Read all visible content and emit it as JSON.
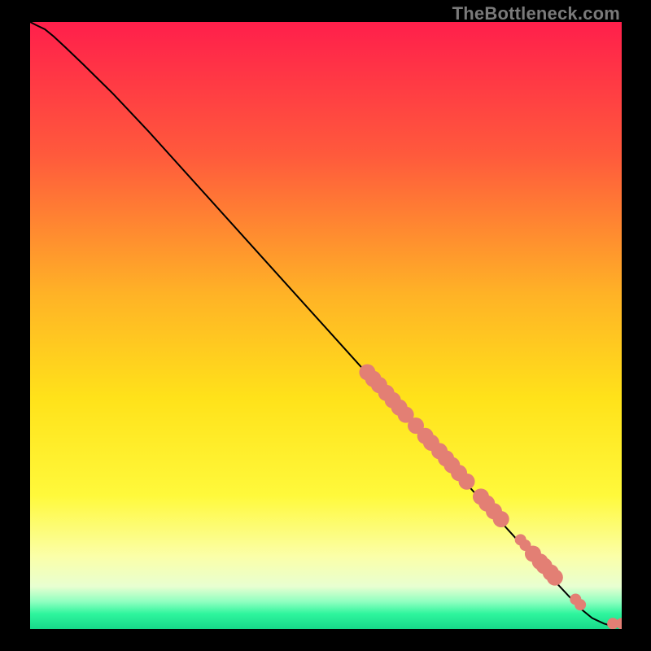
{
  "attribution": "TheBottleneck.com",
  "chart_data": {
    "type": "line",
    "title": "",
    "xlabel": "",
    "ylabel": "",
    "xlim": [
      0,
      100
    ],
    "ylim": [
      0,
      100
    ],
    "grid": false,
    "background": {
      "type": "vertical-gradient",
      "stops": [
        {
          "offset": 0.0,
          "color": "#ff1f4b"
        },
        {
          "offset": 0.22,
          "color": "#ff5a3c"
        },
        {
          "offset": 0.45,
          "color": "#ffb326"
        },
        {
          "offset": 0.62,
          "color": "#ffe21a"
        },
        {
          "offset": 0.78,
          "color": "#fff93b"
        },
        {
          "offset": 0.88,
          "color": "#fbffa8"
        },
        {
          "offset": 0.93,
          "color": "#e8ffd1"
        },
        {
          "offset": 0.955,
          "color": "#8fffc0"
        },
        {
          "offset": 0.975,
          "color": "#2ef59d"
        },
        {
          "offset": 1.0,
          "color": "#17d98a"
        }
      ]
    },
    "series": [
      {
        "name": "main-curve",
        "color": "#000000",
        "x": [
          0.0,
          1.0,
          2.5,
          4.0,
          6.0,
          9.0,
          14.0,
          20.0,
          30.0,
          40.0,
          50.0,
          60.0,
          70.0,
          80.0,
          88.0,
          93.0,
          95.0,
          97.0,
          98.0,
          99.0,
          99.5,
          100.0
        ],
        "y": [
          100.0,
          99.5,
          98.8,
          97.6,
          95.8,
          93.0,
          88.2,
          82.0,
          71.2,
          60.4,
          49.6,
          38.8,
          28.0,
          17.2,
          8.6,
          3.4,
          1.8,
          0.9,
          0.6,
          0.5,
          0.5,
          0.5
        ]
      }
    ],
    "markers": {
      "color": "#e37f74",
      "radius_big": 10,
      "radius_small": 7,
      "points": [
        {
          "x": 57.0,
          "y": 42.3,
          "r": "big"
        },
        {
          "x": 58.0,
          "y": 41.2,
          "r": "big"
        },
        {
          "x": 59.0,
          "y": 40.2,
          "r": "big"
        },
        {
          "x": 60.2,
          "y": 38.9,
          "r": "big"
        },
        {
          "x": 61.3,
          "y": 37.7,
          "r": "big"
        },
        {
          "x": 62.4,
          "y": 36.5,
          "r": "big"
        },
        {
          "x": 63.5,
          "y": 35.3,
          "r": "big"
        },
        {
          "x": 65.2,
          "y": 33.5,
          "r": "big"
        },
        {
          "x": 66.8,
          "y": 31.8,
          "r": "big"
        },
        {
          "x": 67.8,
          "y": 30.7,
          "r": "big"
        },
        {
          "x": 69.2,
          "y": 29.3,
          "r": "big"
        },
        {
          "x": 70.3,
          "y": 28.1,
          "r": "big"
        },
        {
          "x": 71.3,
          "y": 27.0,
          "r": "big"
        },
        {
          "x": 72.5,
          "y": 25.7,
          "r": "big"
        },
        {
          "x": 73.8,
          "y": 24.3,
          "r": "big"
        },
        {
          "x": 76.2,
          "y": 21.8,
          "r": "big"
        },
        {
          "x": 77.2,
          "y": 20.7,
          "r": "big"
        },
        {
          "x": 78.4,
          "y": 19.4,
          "r": "big"
        },
        {
          "x": 79.6,
          "y": 18.1,
          "r": "big"
        },
        {
          "x": 82.9,
          "y": 14.7,
          "r": "small"
        },
        {
          "x": 83.7,
          "y": 13.8,
          "r": "small"
        },
        {
          "x": 85.0,
          "y": 12.4,
          "r": "big"
        },
        {
          "x": 86.2,
          "y": 11.1,
          "r": "big"
        },
        {
          "x": 86.9,
          "y": 10.4,
          "r": "big"
        },
        {
          "x": 88.0,
          "y": 9.3,
          "r": "big"
        },
        {
          "x": 88.7,
          "y": 8.5,
          "r": "big"
        },
        {
          "x": 92.2,
          "y": 4.9,
          "r": "small"
        },
        {
          "x": 93.0,
          "y": 4.0,
          "r": "small"
        },
        {
          "x": 98.5,
          "y": 0.9,
          "r": "small"
        },
        {
          "x": 100.0,
          "y": 0.9,
          "r": "small"
        }
      ]
    }
  }
}
